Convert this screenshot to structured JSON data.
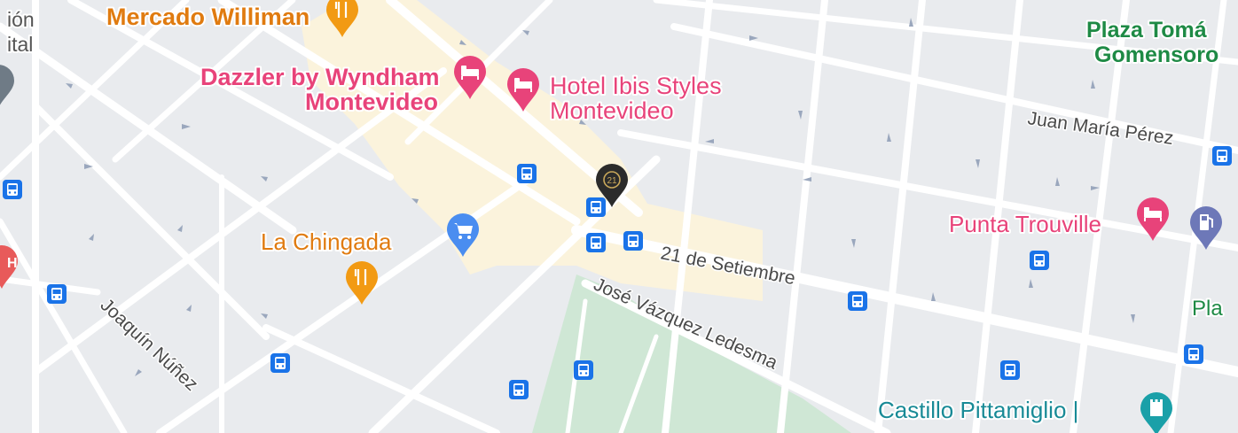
{
  "colors": {
    "land": "#e9ebee",
    "block": "#f0f1f3",
    "road": "#ffffff",
    "highlight_road": "#fbf3dc",
    "park": "#cfe7d5",
    "bus_stop": "#1a73e8",
    "hotel_pin": "#e8437a",
    "restaurant_pin": "#f29a13",
    "shopping_pin": "#4a8df0",
    "gas_pin": "#6d78b8",
    "landmark_pin": "#1aa0a8",
    "brand_pin": "#2b2b2b",
    "hotel_text": "#e8437a",
    "restaurant_text": "#e07b10",
    "park_text": "#1e8a45",
    "landmark_text": "#188a96",
    "street_text": "#4a4a4a"
  },
  "pois": {
    "mercado_williman": "Mercado Williman",
    "dazzler_line1": "Dazzler by Wyndham",
    "dazzler_line2": "Montevideo",
    "ibis_line1": "Hotel Ibis Styles",
    "ibis_line2": "Montevideo",
    "la_chingada": "La Chingada",
    "punta_trouville": "Punta Trouville",
    "plaza_tomas_line1": "Plaza Tomá",
    "plaza_tomas_line2": "Gomensoro",
    "castillo": "Castillo Pittamiglio |",
    "cut_left_line1": "ión",
    "cut_left_line2": "ital",
    "cut_right_pla": "Pla"
  },
  "streets": {
    "juan_maria_perez": "Juan María Pérez",
    "21_de_setiembre": "21 de Setiembre",
    "jose_vazquez_ledesma": "José Vázquez Ledesma",
    "joaquin_nunez": "Joaquín Núñez"
  },
  "icons": {
    "bus_stop": "bus-icon",
    "hotel": "bed-icon",
    "restaurant": "fork-knife-icon",
    "shopping": "cart-icon",
    "gas": "gas-pump-icon",
    "landmark": "tower-icon",
    "brand_marker": "century21-icon"
  },
  "brand_marker_text": "21"
}
